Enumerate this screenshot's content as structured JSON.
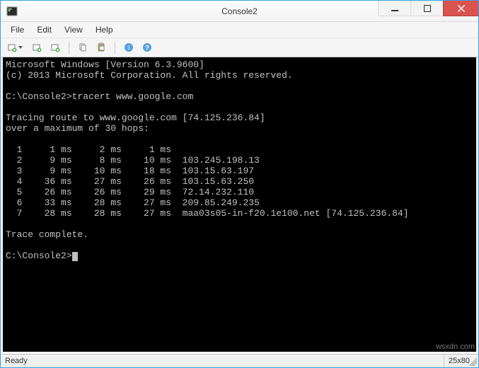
{
  "window": {
    "title": "Console2"
  },
  "menu": {
    "file": "File",
    "edit": "Edit",
    "view": "View",
    "help": "Help"
  },
  "status": {
    "left": "Ready",
    "right": "25x80"
  },
  "console": {
    "header1": "Microsoft Windows [Version 6.3.9600]",
    "header2": "(c) 2013 Microsoft Corporation. All rights reserved.",
    "prompt_path": "C:\\Console2>",
    "command": "tracert www.google.com",
    "trace_line1": "Tracing route to www.google.com [74.125.236.84]",
    "trace_line2": "over a maximum of 30 hops:",
    "hops": [
      {
        "n": 1,
        "t1": "1 ms",
        "t2": "2 ms",
        "t3": "1 ms",
        "host": ""
      },
      {
        "n": 2,
        "t1": "9 ms",
        "t2": "8 ms",
        "t3": "10 ms",
        "host": "103.245.198.13"
      },
      {
        "n": 3,
        "t1": "9 ms",
        "t2": "10 ms",
        "t3": "18 ms",
        "host": "103.15.63.197"
      },
      {
        "n": 4,
        "t1": "36 ms",
        "t2": "27 ms",
        "t3": "26 ms",
        "host": "103.15.63.250"
      },
      {
        "n": 5,
        "t1": "26 ms",
        "t2": "26 ms",
        "t3": "29 ms",
        "host": "72.14.232.110"
      },
      {
        "n": 6,
        "t1": "33 ms",
        "t2": "28 ms",
        "t3": "27 ms",
        "host": "209.85.249.235"
      },
      {
        "n": 7,
        "t1": "28 ms",
        "t2": "28 ms",
        "t3": "27 ms",
        "host": "maa03s05-in-f20.1e100.net [74.125.236.84]"
      }
    ],
    "complete": "Trace complete."
  },
  "watermark": "wsxdn.com"
}
